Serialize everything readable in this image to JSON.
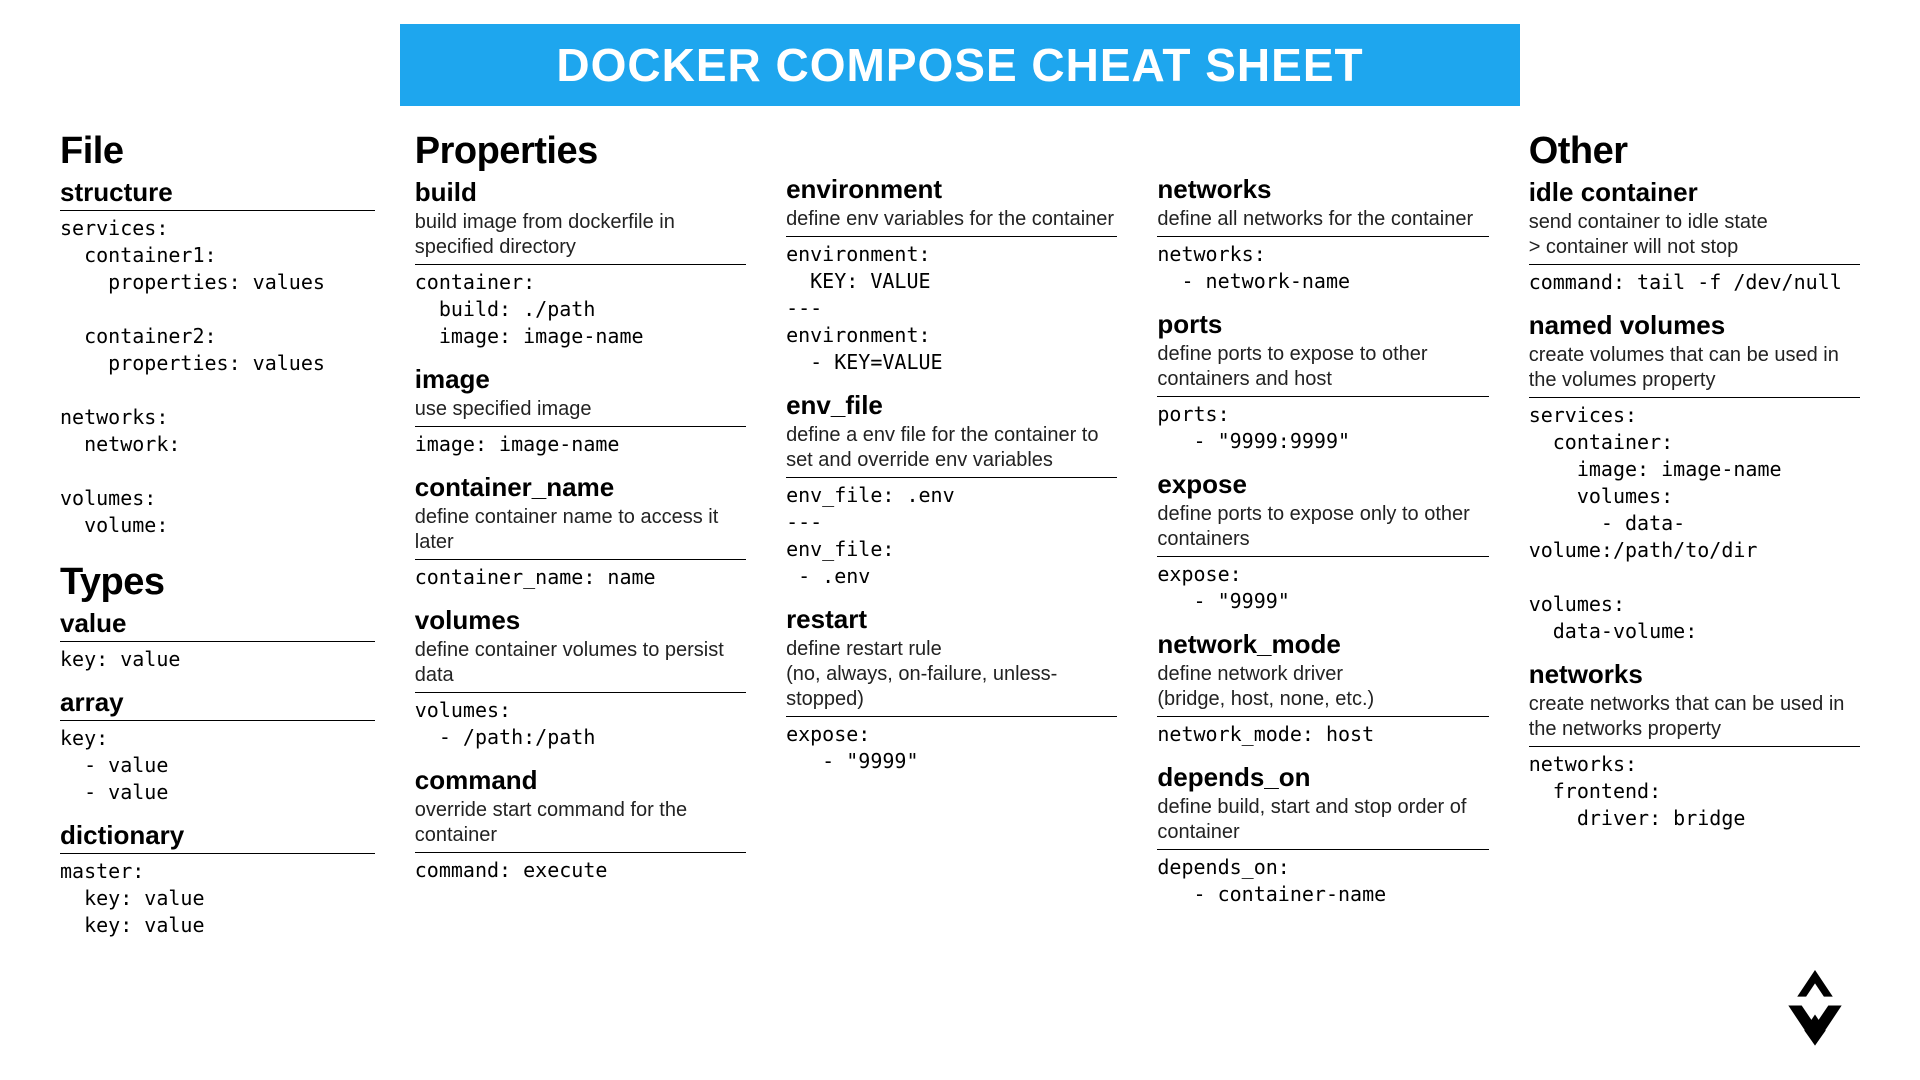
{
  "title": "DOCKER COMPOSE CHEAT SHEET",
  "col1": {
    "cat1": "File",
    "s1": {
      "h": "structure",
      "code": "services:\n  container1:\n    properties: values\n\n  container2:\n    properties: values\n\nnetworks:\n  network:\n\nvolumes:\n  volume:"
    },
    "cat2": "Types",
    "s2": {
      "h": "value",
      "code": "key: value"
    },
    "s3": {
      "h": "array",
      "code": "key:\n  - value\n  - value"
    },
    "s4": {
      "h": "dictionary",
      "code": "master:\n  key: value\n  key: value"
    }
  },
  "col2": {
    "cat": "Properties",
    "s1": {
      "h": "build",
      "d": "build image from dockerfile in specified directory",
      "code": "container:\n  build: ./path\n  image: image-name"
    },
    "s2": {
      "h": "image",
      "d": "use specified image",
      "code": "image: image-name"
    },
    "s3": {
      "h": "container_name",
      "d": "define container name to access it later",
      "code": "container_name: name"
    },
    "s4": {
      "h": "volumes",
      "d": "define container volumes to persist data",
      "code": "volumes:\n  - /path:/path"
    },
    "s5": {
      "h": "command",
      "d": "override start command for the container",
      "code": "command: execute"
    }
  },
  "col3": {
    "s1": {
      "h": "environment",
      "d": "define env variables for the container",
      "code": "environment:\n  KEY: VALUE\n---\nenvironment:\n  - KEY=VALUE"
    },
    "s2": {
      "h": "env_file",
      "d": "define a env file for the container to set and  override env variables",
      "code": "env_file: .env\n---\nenv_file:\n - .env"
    },
    "s3": {
      "h": "restart",
      "d": "define restart rule\n(no, always, on-failure, unless-stopped)",
      "code": "expose:\n   - \"9999\""
    }
  },
  "col4": {
    "s1": {
      "h": "networks",
      "d": "define all networks for the container",
      "code": "networks:\n  - network-name"
    },
    "s2": {
      "h": "ports",
      "d": "define ports to expose to other containers and host",
      "code": "ports:\n   - \"9999:9999\""
    },
    "s3": {
      "h": "expose",
      "d": "define ports to expose only to other containers",
      "code": "expose:\n   - \"9999\""
    },
    "s4": {
      "h": "network_mode",
      "d": "define network driver\n(bridge, host, none, etc.)",
      "code": "network_mode: host"
    },
    "s5": {
      "h": "depends_on",
      "d": "define build, start and stop order of container",
      "code": "depends_on:\n   - container-name"
    }
  },
  "col5": {
    "cat": "Other",
    "s1": {
      "h": "idle container",
      "d": "send container to idle state\n> container will not stop",
      "code": "command: tail -f /dev/null"
    },
    "s2": {
      "h": "named volumes",
      "d": "create volumes that can be used in the volumes property",
      "code": "services:\n  container:\n    image: image-name\n    volumes:\n      - data-\nvolume:/path/to/dir\n\nvolumes:\n  data-volume:"
    },
    "s3": {
      "h": "networks",
      "d": "create networks that can be used in the networks property",
      "code": "networks:\n  frontend:\n    driver: bridge"
    }
  }
}
